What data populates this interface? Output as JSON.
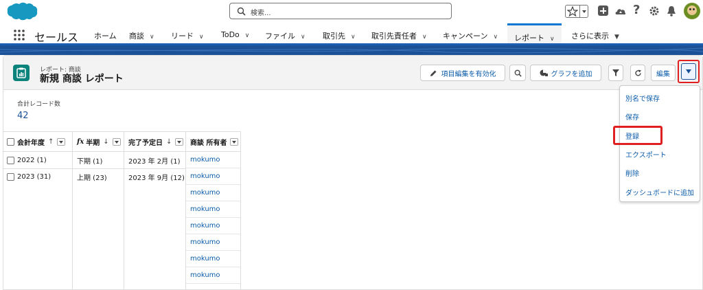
{
  "header": {
    "search_placeholder": "検索...",
    "icons": [
      "favorites-star-icon",
      "favorites-list-icon",
      "add-icon",
      "trailhead-icon",
      "help-icon",
      "setup-gear-icon",
      "notifications-bell-icon",
      "user-avatar"
    ]
  },
  "nav": {
    "app_name": "セールス",
    "items": [
      {
        "label": "ホーム",
        "dropdown": false
      },
      {
        "label": "商談",
        "dropdown": true
      },
      {
        "label": "リード",
        "dropdown": true
      },
      {
        "label": "ToDo",
        "dropdown": true
      },
      {
        "label": "ファイル",
        "dropdown": true
      },
      {
        "label": "取引先",
        "dropdown": true
      },
      {
        "label": "取引先責任者",
        "dropdown": true
      },
      {
        "label": "キャンペーン",
        "dropdown": true
      },
      {
        "label": "レポート",
        "dropdown": true,
        "active": true
      },
      {
        "label": "さらに表示",
        "dropdown": true
      }
    ],
    "chevron": "∨",
    "more_chevron": "▼"
  },
  "report": {
    "breadcrumb": "レポート: 商談",
    "title": "新規 商談 レポート",
    "buttons": {
      "enable_field_editing": "項目編集を有効化",
      "add_chart": "グラフを追加",
      "edit": "編集"
    },
    "record_count_label": "合計レコード数",
    "record_count": "42"
  },
  "table": {
    "columns": [
      {
        "label": "会計年度",
        "sort": "↑"
      },
      {
        "label": "半期",
        "sort": "↓",
        "formula": "fx"
      },
      {
        "label": "完了予定日",
        "sort": "↓"
      },
      {
        "label": "商談 所有者",
        "sort": ""
      }
    ],
    "groups": [
      {
        "fiscal_year": "2022 (1)",
        "half": "下期 (1)",
        "close_date": "2023 年 2月 (1)"
      },
      {
        "fiscal_year": "2023 (31)",
        "half": "上期 (23)",
        "close_date": "2023 年 9月 (12)"
      }
    ],
    "owners": [
      "mokumo",
      "mokumo",
      "mokumo",
      "mokumo",
      "mokumo",
      "mokumo",
      "mokumo",
      "mokumo"
    ]
  },
  "menu": {
    "items": [
      "別名で保存",
      "保存",
      "登録",
      "エクスポート",
      "削除",
      "ダッシュボードに追加"
    ],
    "highlighted": "登録"
  },
  "colors": {
    "brand_blue": "#0176d3",
    "band_blue": "#1b5297",
    "highlight_red": "#e02020",
    "report_icon_teal": "#0b827c"
  }
}
